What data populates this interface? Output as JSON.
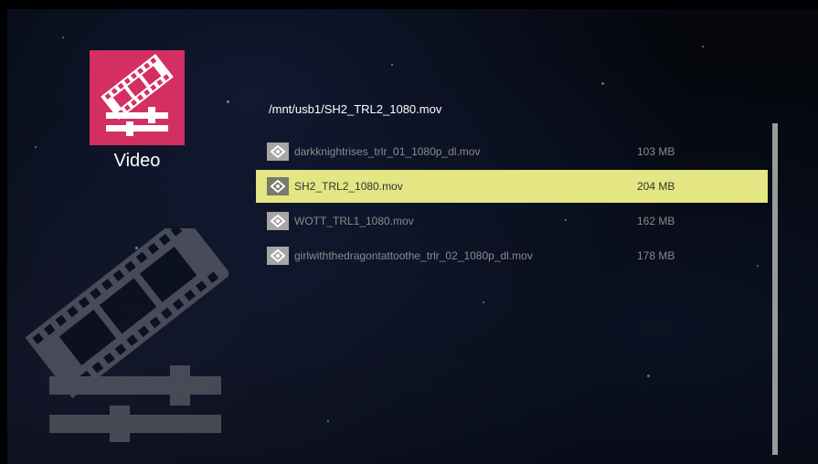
{
  "app": {
    "label": "Video",
    "accent": "#d42f62",
    "icon": "film-reel-sliders-icon"
  },
  "path": "/mnt/usb1/SH2_TRL2_1080.mov",
  "files": [
    {
      "name": "darkknightrises_trlr_01_1080p_dl.mov",
      "size": "103  MB",
      "selected": false
    },
    {
      "name": "SH2_TRL2_1080.mov",
      "size": "204  MB",
      "selected": true
    },
    {
      "name": "WOTT_TRL1_1080.mov",
      "size": "162  MB",
      "selected": false
    },
    {
      "name": "girlwiththedragontattoothe_trlr_02_1080p_dl.mov",
      "size": "178  MB",
      "selected": false
    }
  ],
  "colors": {
    "selection": "#e4e583",
    "background": "#05070d"
  }
}
